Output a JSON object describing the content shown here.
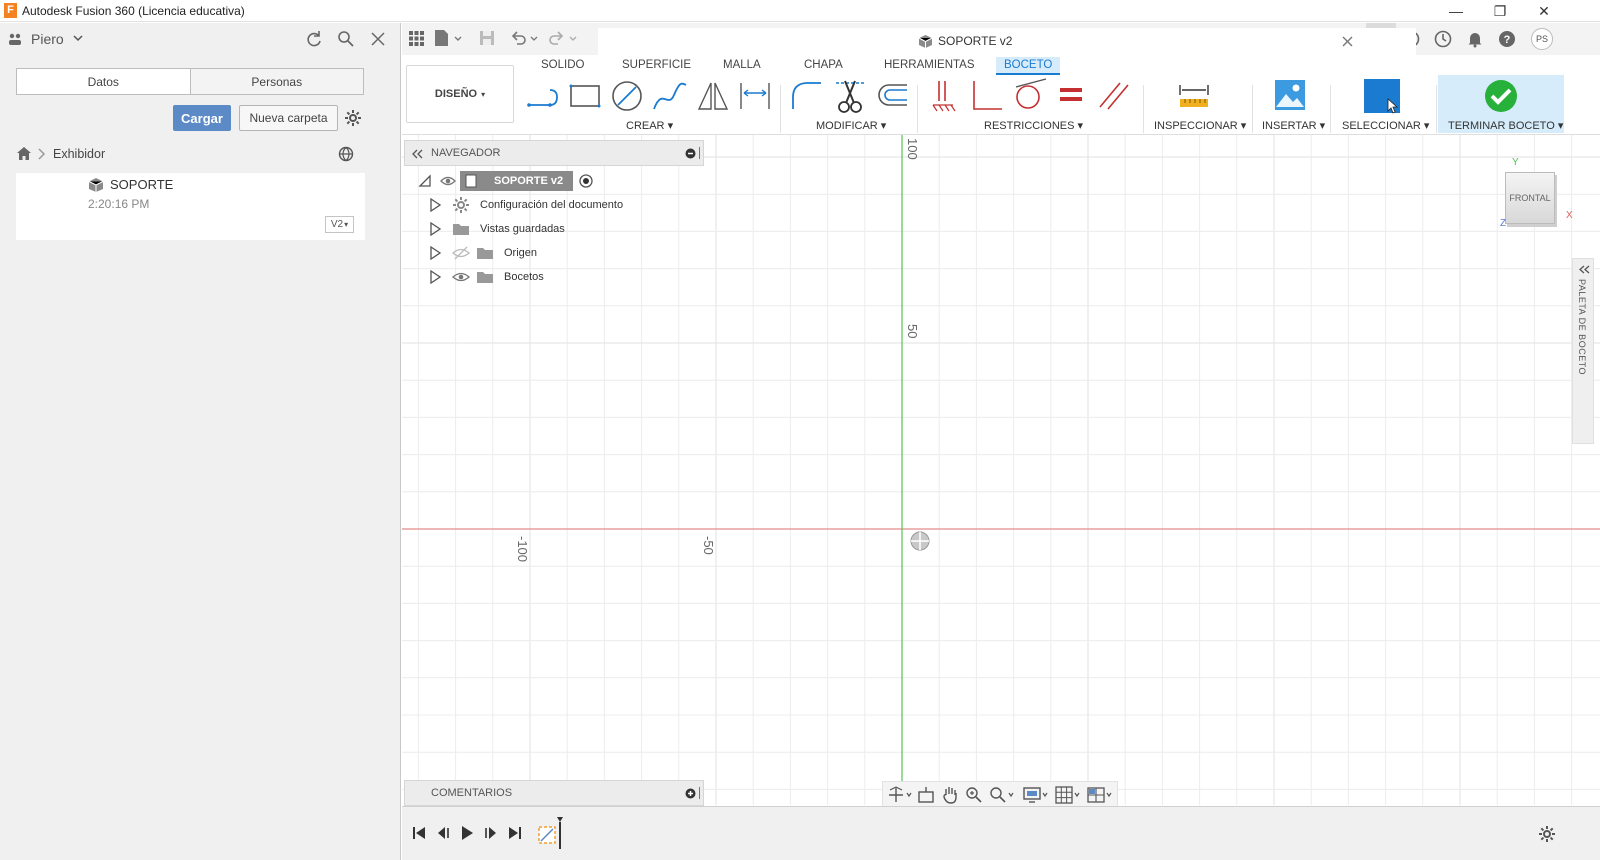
{
  "window": {
    "title": "Autodesk Fusion 360 (Licencia educativa)",
    "minimize": "—",
    "restore": "❐",
    "close": "✕"
  },
  "data_panel": {
    "user": "Piero",
    "tabs": [
      "Datos",
      "Personas"
    ],
    "upload_label": "Cargar",
    "new_folder_label": "Nueva carpeta",
    "breadcrumb": "Exhibidor",
    "file": {
      "name": "SOPORTE",
      "time": "2:20:16 PM",
      "version": "V2"
    }
  },
  "document": {
    "tab_title": "SOPORTE v2",
    "user_initials": "PS"
  },
  "ribbon": {
    "workspace": "DISEÑO",
    "tabs": [
      "SOLIDO",
      "SUPERFICIE",
      "MALLA",
      "CHAPA",
      "HERRAMIENTAS",
      "BOCETO"
    ],
    "active_tab": "BOCETO",
    "groups": {
      "create": "CREAR",
      "modify": "MODIFICAR",
      "constraints": "RESTRICCIONES",
      "inspect": "INSPECCIONAR",
      "insert": "INSERTAR",
      "select": "SELECCIONAR",
      "finish": "TERMINAR BOCETO"
    },
    "accent": "#1a7bd1",
    "finish_color": "#27b03a"
  },
  "browser": {
    "title": "NAVEGADOR",
    "root": "SOPORTE v2",
    "items": [
      "Configuración del documento",
      "Vistas guardadas",
      "Origen",
      "Bocetos"
    ]
  },
  "comments": {
    "title": "COMENTARIOS"
  },
  "viewcube": {
    "face": "FRONTAL",
    "axis_y": "Y",
    "axis_x": "X",
    "axis_z": "Z"
  },
  "sketch_palette": {
    "label": "PALETA DE BOCETO"
  },
  "axes_labels": {
    "top": "100",
    "mid": "50",
    "neg100": "-100",
    "neg50": "-50"
  },
  "colors": {
    "x_axis": "#e58b8b",
    "y_axis": "#55c255",
    "grid": "#ececec"
  }
}
